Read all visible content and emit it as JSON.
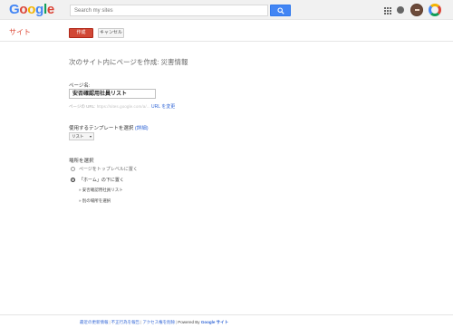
{
  "header": {
    "logo_letters": [
      {
        "ch": "G",
        "color": "#4285f4"
      },
      {
        "ch": "o",
        "color": "#db4437"
      },
      {
        "ch": "o",
        "color": "#f4b400"
      },
      {
        "ch": "g",
        "color": "#4285f4"
      },
      {
        "ch": "l",
        "color": "#0f9d58"
      },
      {
        "ch": "e",
        "color": "#db4437"
      }
    ],
    "search_placeholder": "Search my sites"
  },
  "toolbar": {
    "section_title": "サイト",
    "create_label": "作成",
    "cancel_label": "キャンセル"
  },
  "main": {
    "heading": "次のサイト内にページを作成: 災害情報",
    "page_name_label": "ページ名:",
    "page_name_value": "安否確認用社員リスト",
    "url_prefix": "ページの URL:",
    "url_blurred": "https://sites.google.com/a/...",
    "url_change_link": "URL を変更",
    "template_label": "使用するテンプレートを選択",
    "template_detail_link": "(詳細)",
    "template_value": "リスト",
    "location_label": "場所を選択",
    "radio_top": "ページをトップレベルに置く",
    "radio_under": "「ホーム」の下に置く",
    "tree_item_1": "» 安否確認用社員リスト",
    "tree_item_2": "» 別の場所を選択"
  },
  "footer": {
    "link_recent": "最近の更新情報",
    "link_abuse": "不正行為を報告",
    "link_print": "アクセス権を削除",
    "powered": "Powered By",
    "brand": "Google サイト"
  }
}
